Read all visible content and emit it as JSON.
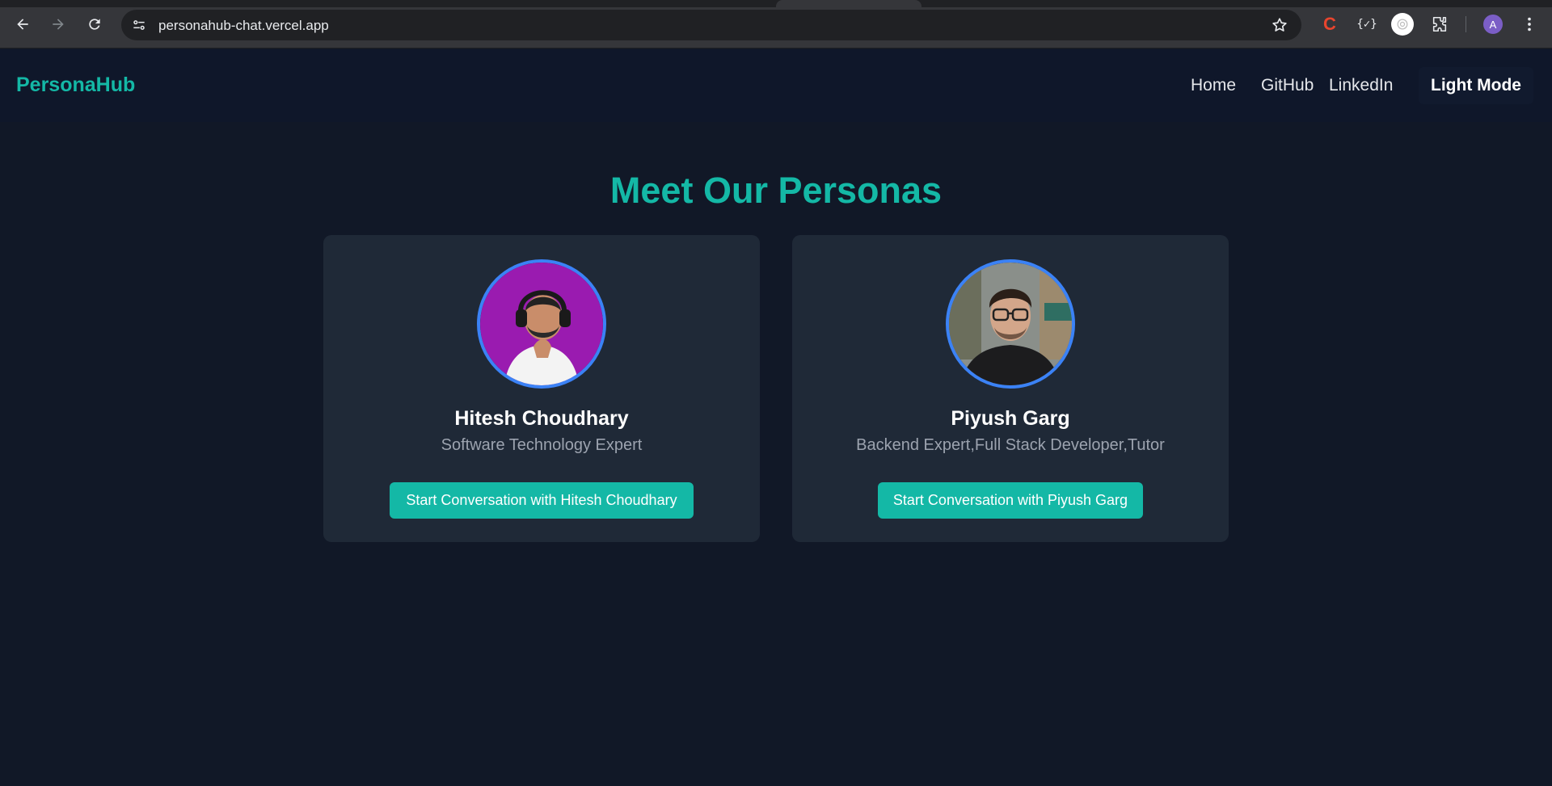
{
  "browser": {
    "url": "personahub-chat.vercel.app",
    "profile_initial": "A",
    "ext_c_label": "C",
    "ext_json_label": "{✓}"
  },
  "header": {
    "brand": "PersonaHub",
    "nav": [
      "Home",
      "GitHub",
      "LinkedIn"
    ],
    "theme_toggle": "Light Mode"
  },
  "main": {
    "title": "Meet Our Personas",
    "personas": [
      {
        "name": "Hitesh Choudhary",
        "role": "Software Technology Expert",
        "button": "Start Conversation with Hitesh Choudhary"
      },
      {
        "name": "Piyush Garg",
        "role": "Backend Expert,Full Stack Developer,Tutor",
        "button": "Start Conversation with Piyush Garg"
      }
    ]
  },
  "colors": {
    "accent": "#14b8a6",
    "avatar_ring": "#3b82f6",
    "background": "#111827",
    "card": "#1f2937"
  }
}
